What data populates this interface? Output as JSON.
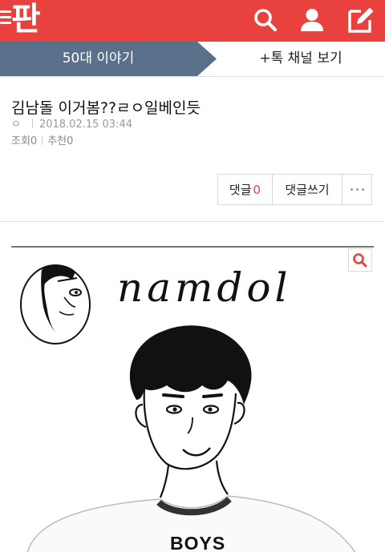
{
  "header": {
    "logo": "판",
    "icons": [
      "menu-icon",
      "search-icon",
      "user-icon",
      "write-icon"
    ],
    "color": "#e8413e"
  },
  "channel": {
    "name": "50대 이야기",
    "more_label": "+톡 채널 보기",
    "tab_color": "#5a708a"
  },
  "post": {
    "title": "김남돌 이거봄??ㄹㅇ일베인듯",
    "author": "ㅇ",
    "date": "2018.02.15 03:44",
    "views_label": "조회",
    "views": "0",
    "recommend_label": "추천",
    "recommends": "0"
  },
  "actions": {
    "comment_label": "댓글",
    "comment_count": "0",
    "write_label": "댓글쓰기",
    "more_icon": "more-dots-icon"
  },
  "image": {
    "caption": "namdol",
    "shirt_text": "BOYS",
    "zoom_icon": "zoom-icon"
  }
}
